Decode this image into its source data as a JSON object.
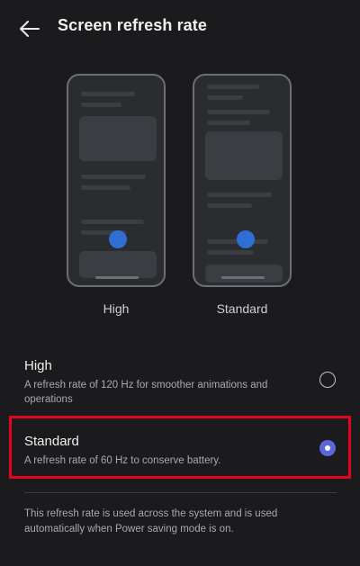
{
  "header": {
    "title": "Screen refresh rate"
  },
  "previews": [
    {
      "label": "High"
    },
    {
      "label": "Standard"
    }
  ],
  "options": [
    {
      "title": "High",
      "description": "A refresh rate of 120 Hz for smoother animations and operations",
      "selected": false
    },
    {
      "title": "Standard",
      "description": "A refresh rate of 60 Hz to conserve battery.",
      "selected": true
    }
  ],
  "footnote": "This refresh rate is used across the system and is used automatically when Power saving mode is on.",
  "colors": {
    "accent": "#5a67d8",
    "highlight": "#e1061e",
    "background": "#1b1b1d"
  }
}
